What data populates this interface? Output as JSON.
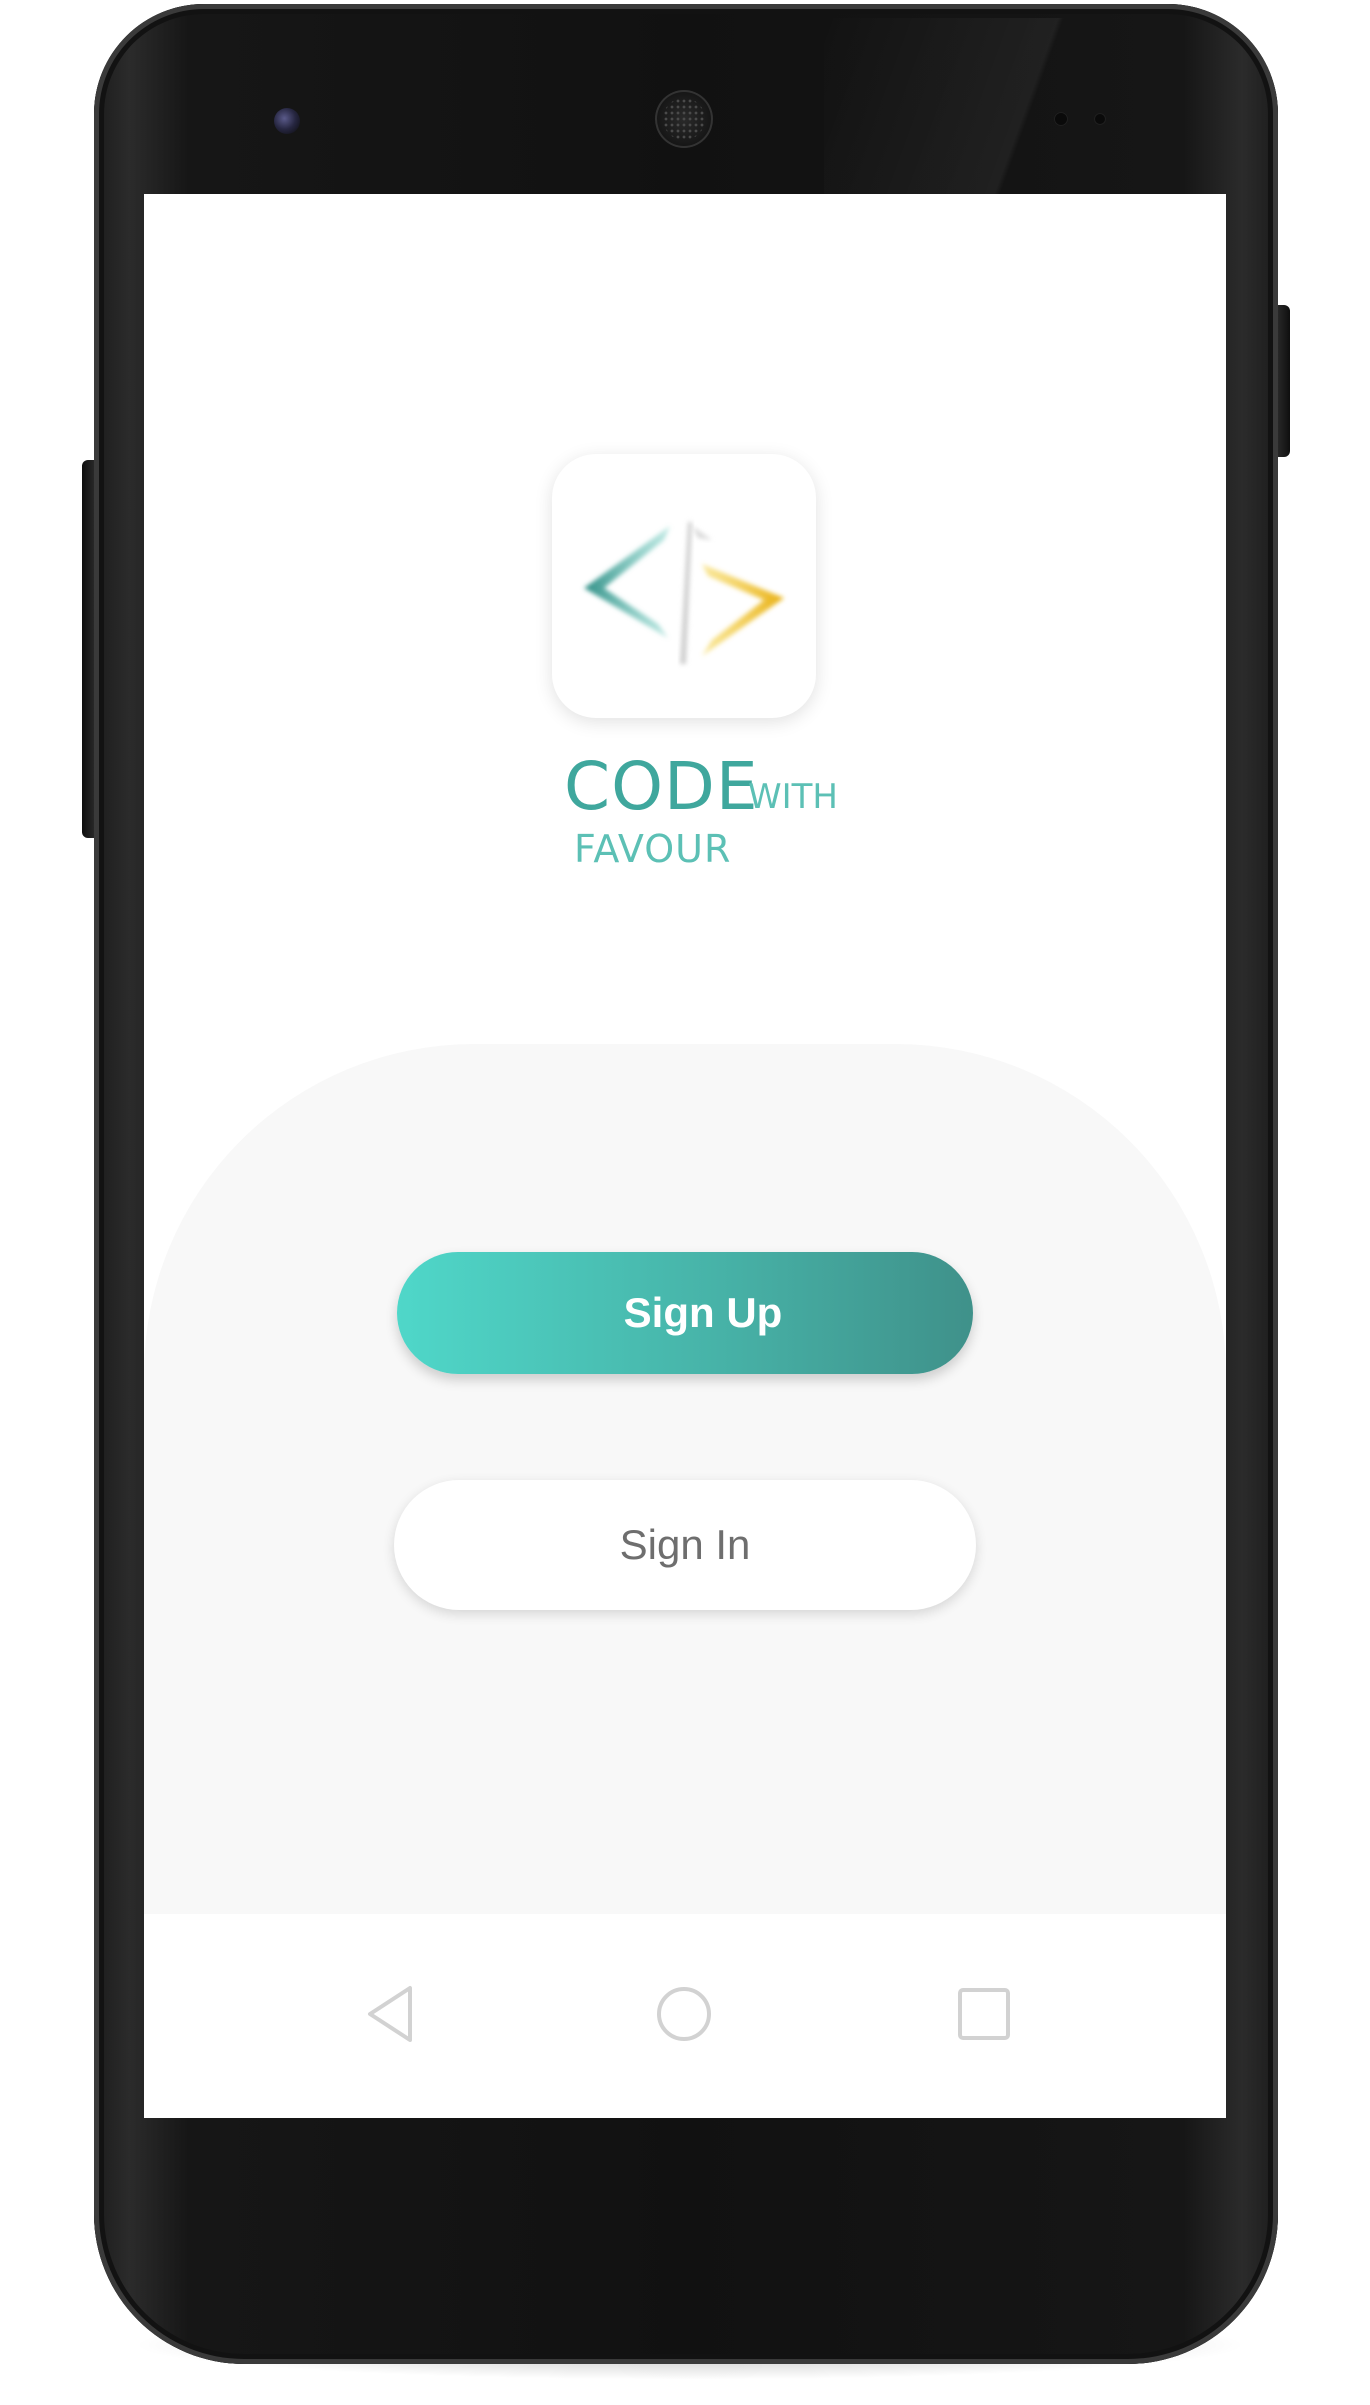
{
  "brand": {
    "code": "CODE",
    "with": "WITH",
    "favour": "FAVOUR",
    "colors": {
      "teal": "#3fa79d",
      "light_teal": "#5cc0b5",
      "yellow": "#f2c02b"
    }
  },
  "logo": {
    "icon": "code-brackets-logo-icon"
  },
  "actions": {
    "signup_label": "Sign Up",
    "signin_label": "Sign In"
  },
  "navigation": {
    "back_icon": "back-triangle-icon",
    "home_icon": "home-circle-icon",
    "recents_icon": "recents-square-icon"
  },
  "theme": {
    "gradient_start": "#4fd7c9",
    "gradient_end": "#3f918a",
    "hero_background": "#f8f8f8"
  }
}
